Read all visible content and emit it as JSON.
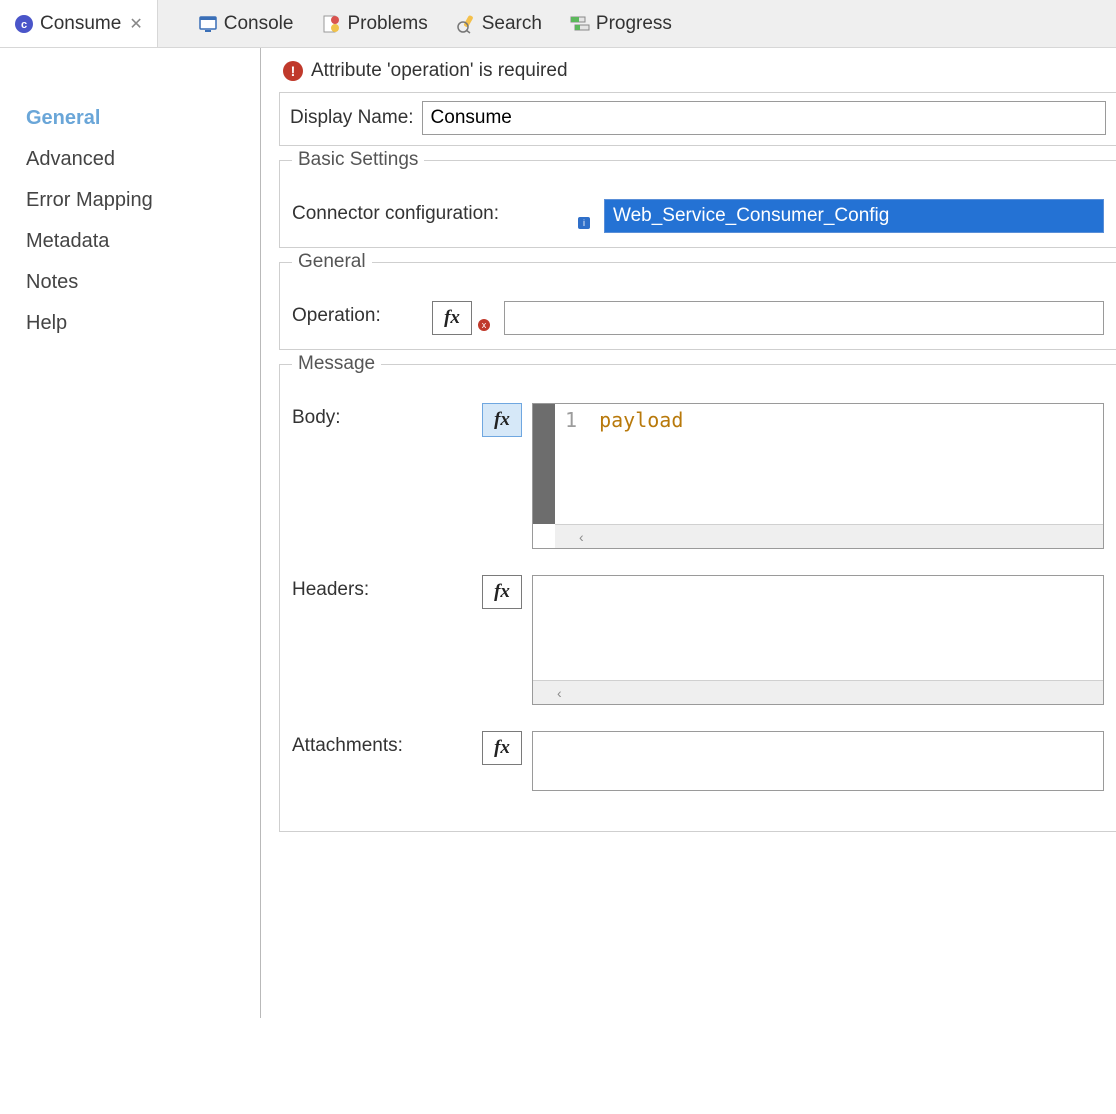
{
  "tabs": {
    "active": {
      "label": "Consume"
    },
    "console": {
      "label": "Console"
    },
    "problems": {
      "label": "Problems"
    },
    "search": {
      "label": "Search"
    },
    "progress": {
      "label": "Progress"
    }
  },
  "sidebar": {
    "items": [
      {
        "label": "General",
        "selected": true
      },
      {
        "label": "Advanced",
        "selected": false
      },
      {
        "label": "Error Mapping",
        "selected": false
      },
      {
        "label": "Metadata",
        "selected": false
      },
      {
        "label": "Notes",
        "selected": false
      },
      {
        "label": "Help",
        "selected": false
      }
    ]
  },
  "error_message": "Attribute 'operation' is required",
  "display_name": {
    "label": "Display Name:",
    "value": "Consume"
  },
  "basic_settings": {
    "legend": "Basic Settings",
    "connector_label": "Connector configuration:",
    "connector_value": "Web_Service_Consumer_Config"
  },
  "general_group": {
    "legend": "General",
    "operation_label": "Operation:",
    "operation_value": ""
  },
  "message_group": {
    "legend": "Message",
    "body_label": "Body:",
    "body_line_no": "1",
    "body_code": "payload",
    "headers_label": "Headers:",
    "attachments_label": "Attachments:"
  },
  "fx_label": "fx"
}
